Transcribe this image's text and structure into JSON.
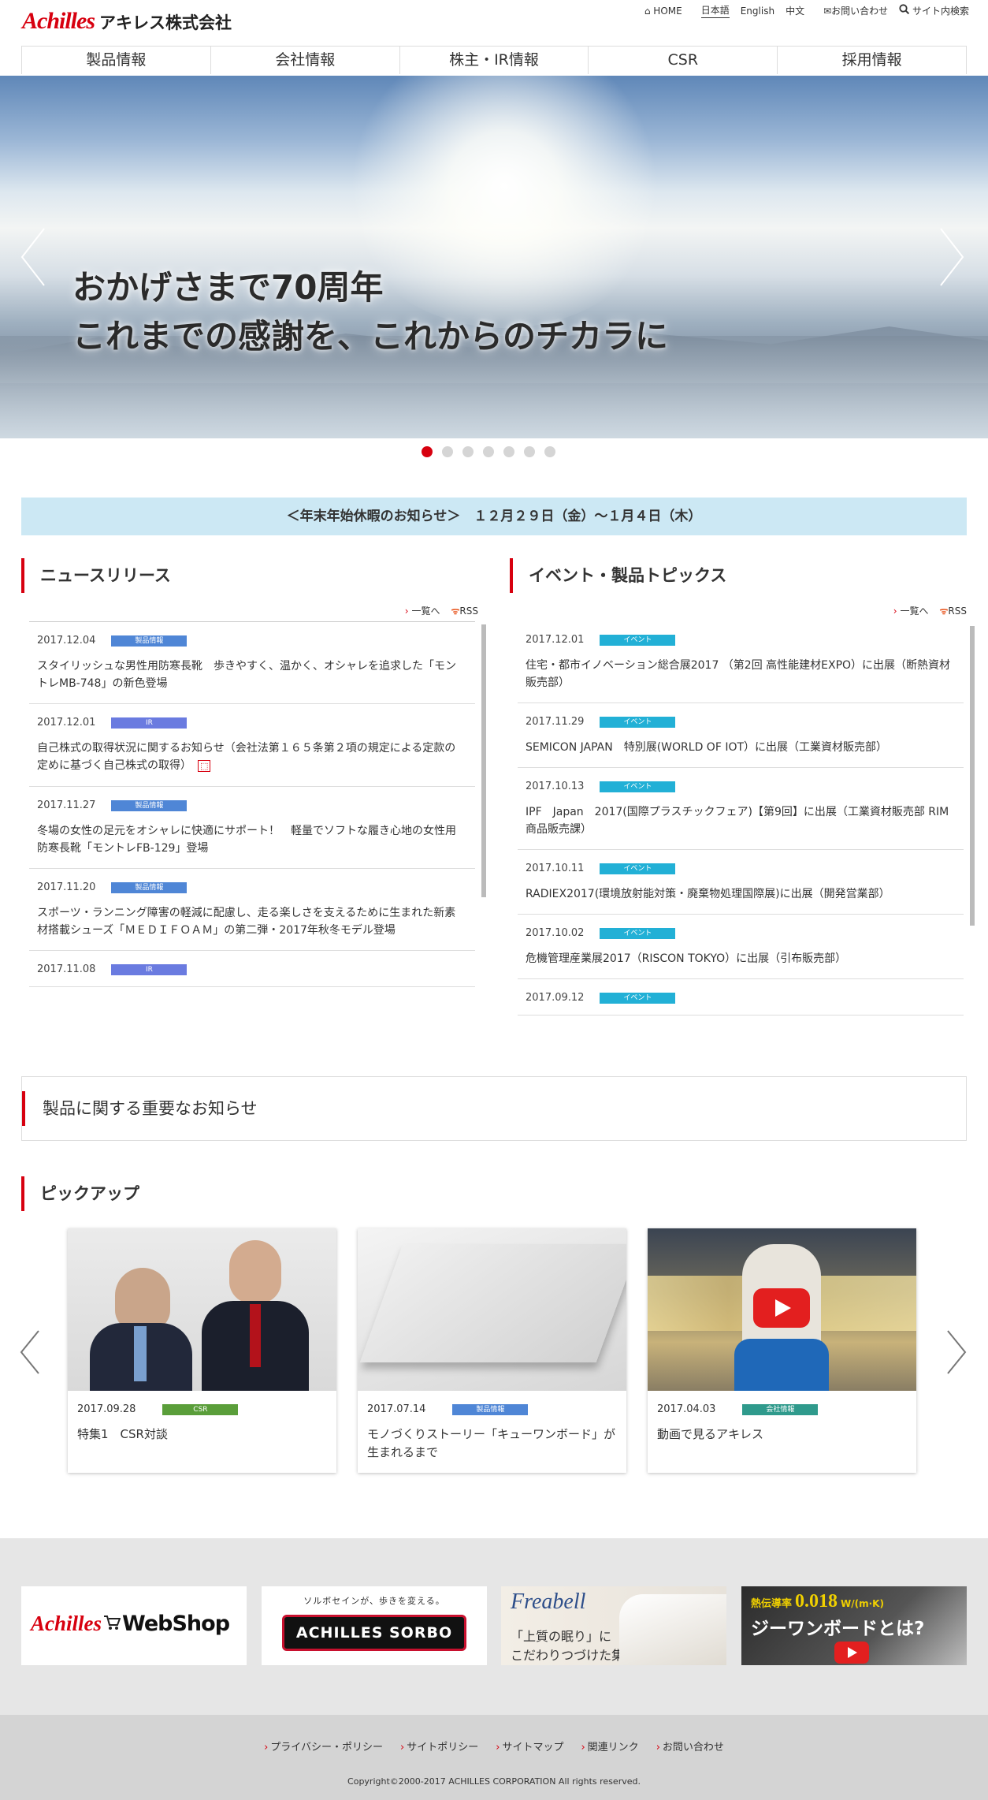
{
  "header": {
    "logo_brand": "Achilles",
    "logo_company": "アキレス株式会社",
    "util": {
      "home": "HOME",
      "lang_ja": "日本語",
      "lang_en": "English",
      "lang_zh": "中文",
      "contact": "お問い合わせ",
      "search": "サイト内検索"
    },
    "nav": [
      "製品情報",
      "会社情報",
      "株主・IR情報",
      "CSR",
      "採用情報"
    ]
  },
  "hero": {
    "line1": "おかげさまで70周年",
    "line2": "これまでの感謝を、これからのチカラに",
    "prev_glyph": "〈",
    "next_glyph": "〉",
    "slide_count": 7,
    "active_slide": 1
  },
  "notice": "＜年末年始休暇のお知らせ＞　１２月２９日（金）～１月４日（木）",
  "news": {
    "title": "ニュースリリース",
    "list_link": "一覧へ",
    "rss": "RSS",
    "items": [
      {
        "date": "2017.12.04",
        "tag": "製品情報",
        "tag_color": "#4f86d6",
        "text": "スタイリッシュな男性用防寒長靴　歩きやすく、温かく、オシャレを追求した「モントレMB-748」の新色登場"
      },
      {
        "date": "2017.12.01",
        "tag": "IR",
        "tag_color": "#6a7be0",
        "text": "自己株式の取得状況に関するお知らせ（会社法第１６５条第２項の規定による定款の定めに基づく自己株式の取得）",
        "pdf": "PDF"
      },
      {
        "date": "2017.11.27",
        "tag": "製品情報",
        "tag_color": "#4f86d6",
        "text": "冬場の女性の足元をオシャレに快適にサポート！　軽量でソフトな履き心地の女性用防寒長靴「モントレFB-129」登場"
      },
      {
        "date": "2017.11.20",
        "tag": "製品情報",
        "tag_color": "#4f86d6",
        "text": "スポーツ・ランニング障害の軽減に配慮し、走る楽しさを支えるために生まれた新素材搭載シューズ「ＭＥＤＩＦＯＡＭ」の第二弾・2017年秋冬モデル登場"
      },
      {
        "date": "2017.11.08",
        "tag": "IR",
        "tag_color": "#6a7be0",
        "text": ""
      }
    ]
  },
  "events": {
    "title": "イベント・製品トピックス",
    "list_link": "一覧へ",
    "rss": "RSS",
    "items": [
      {
        "date": "2017.12.01",
        "tag": "イベント",
        "tag_color": "#22b0d6",
        "text": "住宅・都市イノベーション総合展2017 （第2回 高性能建材EXPO）に出展（断熱資材販売部）"
      },
      {
        "date": "2017.11.29",
        "tag": "イベント",
        "tag_color": "#22b0d6",
        "text": "SEMICON JAPAN　特別展(WORLD OF IOT）に出展（工業資材販売部）"
      },
      {
        "date": "2017.10.13",
        "tag": "イベント",
        "tag_color": "#22b0d6",
        "text": "IPF　Japan　2017(国際プラスチックフェア)【第9回】に出展（工業資材販売部 RIM商品販売課）"
      },
      {
        "date": "2017.10.11",
        "tag": "イベント",
        "tag_color": "#22b0d6",
        "text": "RADIEX2017(環境放射能対策・廃棄物処理国際展)に出展（開発営業部）"
      },
      {
        "date": "2017.10.02",
        "tag": "イベント",
        "tag_color": "#22b0d6",
        "text": "危機管理産業展2017（RISCON TOKYO）に出展（引布販売部）"
      },
      {
        "date": "2017.09.12",
        "tag": "イベント",
        "tag_color": "#22b0d6",
        "text": ""
      }
    ]
  },
  "important": {
    "title": "製品に関する重要なお知らせ"
  },
  "pickup": {
    "title": "ピックアップ",
    "prev_glyph": "〈",
    "next_glyph": "〉",
    "cards": [
      {
        "date": "2017.09.28",
        "tag": "CSR",
        "tag_color": "#5a9e3a",
        "text": "特集1　CSR対談"
      },
      {
        "date": "2017.07.14",
        "tag": "製品情報",
        "tag_color": "#4f86d6",
        "text": "モノづくりストーリー「キューワンボード」が生まれるまで"
      },
      {
        "date": "2017.04.03",
        "tag": "会社情報",
        "tag_color": "#2f9a8c",
        "text": "動画で見るアキレス"
      }
    ]
  },
  "banners": {
    "webshop": {
      "brand": "Achilles",
      "label": "WebShop"
    },
    "sorbo": {
      "tagline": "ソルボセインが、歩きを変える。",
      "label": "ACHILLES SORBO"
    },
    "freabell": {
      "brand": "Freabell",
      "line1": "「上質の眠り」に",
      "line2": "こだわりつづけた集大成。"
    },
    "qone": {
      "line1_prefix": "熱伝導率",
      "value": "0.018",
      "unit": "W/(m·K)",
      "line2": "ジーワンボードとは?"
    }
  },
  "footer": {
    "links": [
      "プライバシー・ポリシー",
      "サイトポリシー",
      "サイトマップ",
      "関連リンク",
      "お問い合わせ"
    ],
    "copyright": "Copyright©2000-2017 ACHILLES CORPORATION All rights reserved."
  },
  "colors": {
    "brand_red": "#d7000f",
    "notice_bg": "#cce8f4",
    "footer_bg": "#d4d4d4"
  }
}
